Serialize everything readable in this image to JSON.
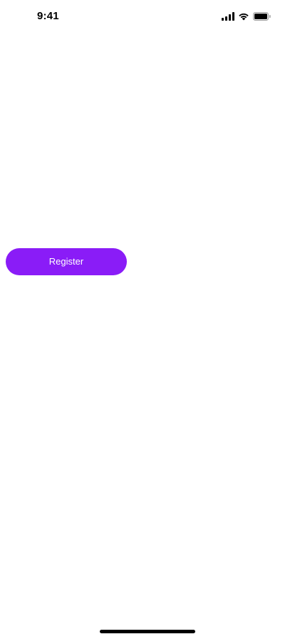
{
  "status_bar": {
    "time": "9:41",
    "icons": [
      "cellular-signal-icon",
      "wifi-icon",
      "battery-icon"
    ]
  },
  "main": {
    "register_label": "Register"
  },
  "colors": {
    "accent": "#8A1CF7",
    "background": "#FFFFFF",
    "text_on_accent": "#FFFFFF",
    "status_foreground": "#000000"
  }
}
